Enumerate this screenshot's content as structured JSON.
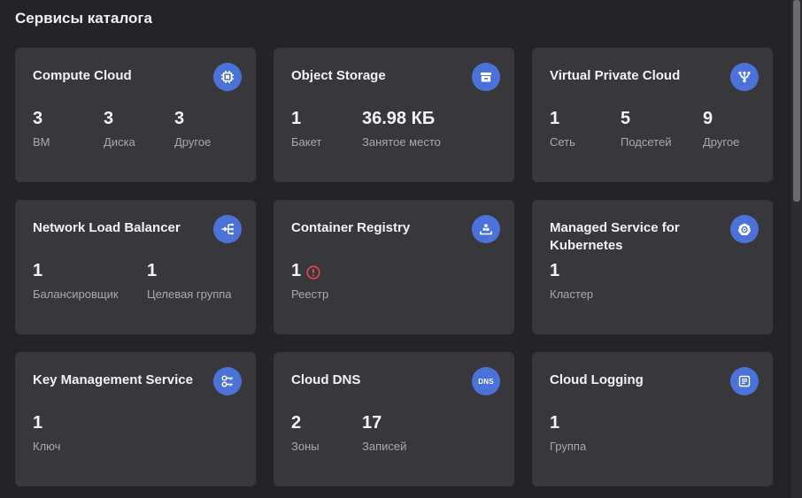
{
  "page": {
    "title": "Сервисы каталога"
  },
  "colors": {
    "background": "#242327",
    "card": "#38373c",
    "icon_accent": "#4a72d9",
    "warning": "#e5484d",
    "label": "#a9a8ae"
  },
  "cards": [
    {
      "title": "Compute Cloud",
      "icon": "compute-chip-icon",
      "stats": [
        {
          "value": "3",
          "label": "ВМ"
        },
        {
          "value": "3",
          "label": "Диска"
        },
        {
          "value": "3",
          "label": "Другое"
        }
      ]
    },
    {
      "title": "Object Storage",
      "icon": "storage-box-icon",
      "stats": [
        {
          "value": "1",
          "label": "Бакет"
        },
        {
          "value": "36.98 КБ",
          "label": "Занятое место"
        }
      ]
    },
    {
      "title": "Virtual Private Cloud",
      "icon": "network-topology-icon",
      "stats": [
        {
          "value": "1",
          "label": "Сеть"
        },
        {
          "value": "5",
          "label": "Подсетей"
        },
        {
          "value": "9",
          "label": "Другое"
        }
      ]
    },
    {
      "title": "Network Load Balancer",
      "icon": "load-balancer-icon",
      "stats": [
        {
          "value": "1",
          "label": "Балансировщик"
        },
        {
          "value": "1",
          "label": "Целевая группа"
        }
      ]
    },
    {
      "title": "Container Registry",
      "icon": "container-registry-icon",
      "stats": [
        {
          "value": "1",
          "label": "Реестр",
          "warning": true
        }
      ]
    },
    {
      "title": "Managed Service for Kubernetes",
      "icon": "kubernetes-icon",
      "stats": [
        {
          "value": "1",
          "label": "Кластер"
        }
      ]
    },
    {
      "title": "Key Management Service",
      "icon": "key-management-icon",
      "stats": [
        {
          "value": "1",
          "label": "Ключ"
        }
      ]
    },
    {
      "title": "Cloud DNS",
      "icon": "dns-icon",
      "icon_text": "DNS",
      "stats": [
        {
          "value": "2",
          "label": "Зоны"
        },
        {
          "value": "17",
          "label": "Записей"
        }
      ]
    },
    {
      "title": "Cloud Logging",
      "icon": "logging-lines-icon",
      "stats": [
        {
          "value": "1",
          "label": "Группа"
        }
      ]
    }
  ]
}
